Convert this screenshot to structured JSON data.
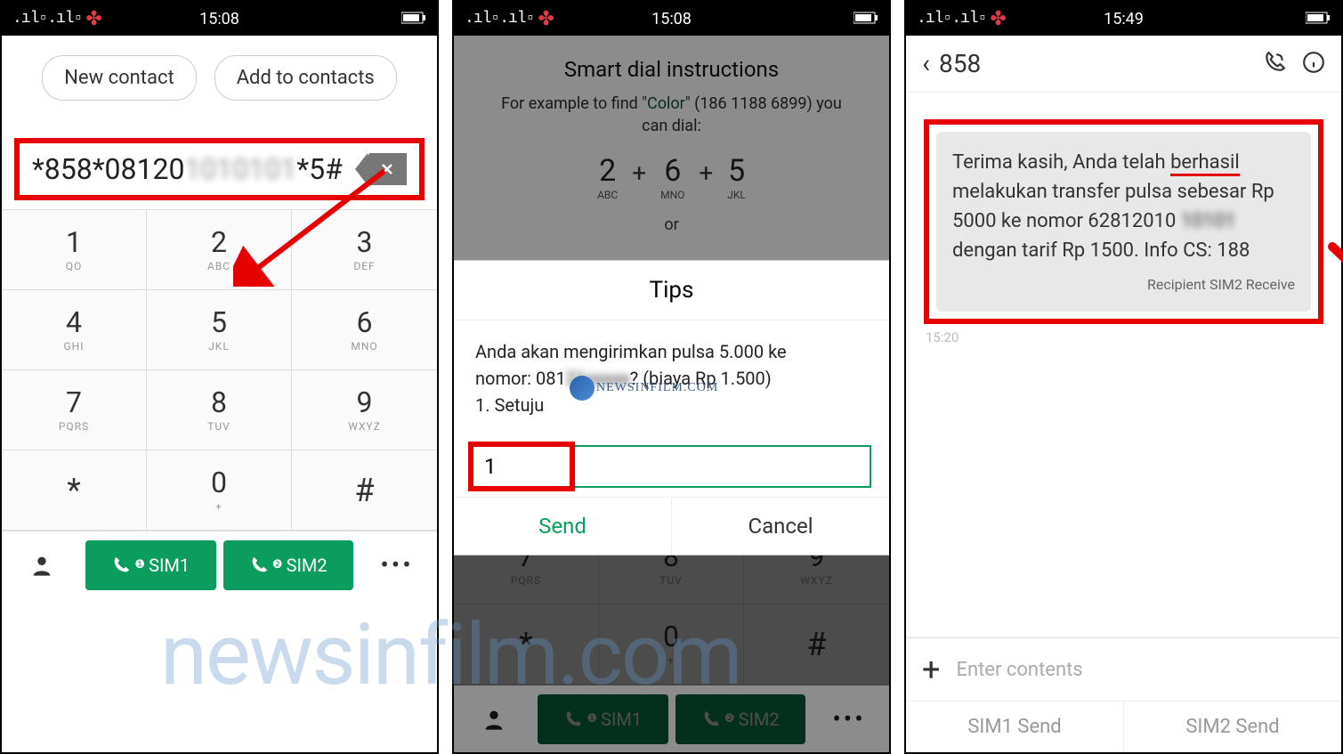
{
  "status": {
    "time1": "15:08",
    "time2": "15:08",
    "time3": "15:49"
  },
  "screen1": {
    "new_contact": "New contact",
    "add_contacts": "Add to contacts",
    "dial_prefix": "*858*08120",
    "dial_blur": "1010101",
    "dial_suffix": "*5#",
    "keys": [
      {
        "n": "1",
        "s": "QO"
      },
      {
        "n": "2",
        "s": "ABC"
      },
      {
        "n": "3",
        "s": "DEF"
      },
      {
        "n": "4",
        "s": "GHI"
      },
      {
        "n": "5",
        "s": "JKL"
      },
      {
        "n": "6",
        "s": "MNO"
      },
      {
        "n": "7",
        "s": "PQRS"
      },
      {
        "n": "8",
        "s": "TUV"
      },
      {
        "n": "9",
        "s": "WXYZ"
      },
      {
        "n": "*",
        "s": ""
      },
      {
        "n": "0",
        "s": "+"
      },
      {
        "n": "#",
        "s": ""
      }
    ],
    "sim1": "SIM1",
    "sim2": "SIM2"
  },
  "screen2": {
    "smart_title": "Smart dial instructions",
    "smart_sub_pre": "For example to find \"",
    "smart_sub_color": "Color",
    "smart_sub_post": "\" (186 1188 6899) you can dial:",
    "ex": [
      {
        "n": "2",
        "s": "ABC"
      },
      {
        "n": "6",
        "s": "MNO"
      },
      {
        "n": "5",
        "s": "JKL"
      }
    ],
    "or": "or",
    "tips": "Tips",
    "body_l1": "Anda akan mengirimkan pulsa 5.000 ke",
    "body_l2a": "nomor: 081",
    "body_l2blur": "21",
    "body_l2b": "? (biaya Rp 1.500)",
    "body_l3": "1. Setuju",
    "input": "1",
    "send": "Send",
    "cancel": "Cancel",
    "sim1": "SIM1",
    "sim2": "SIM2"
  },
  "screen3": {
    "title": "858",
    "msg_l1": "Terima kasih, Anda telah ",
    "msg_underline": "berhasil",
    "msg_l2": " melakukan transfer pulsa sebesar Rp 5000 ke nomor 62812010 ",
    "msg_blur": "10101",
    "msg_l3": " dengan tarif Rp 1500. Info CS: 188",
    "recipient": "Recipient SIM2 Receive",
    "time": "15:20",
    "placeholder": "Enter contents",
    "sim1": "SIM1 Send",
    "sim2": "SIM2 Send"
  },
  "watermark": "newsinfilm.com",
  "wm_small": "NEWSINFILM.COM"
}
